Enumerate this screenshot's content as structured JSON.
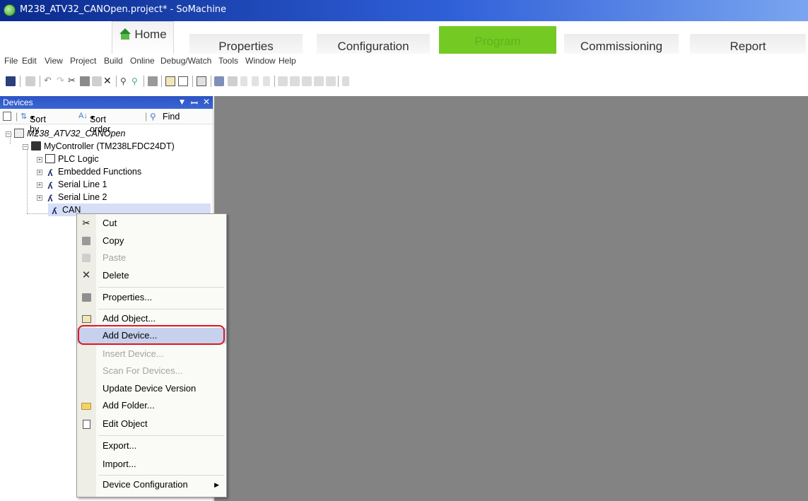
{
  "window": {
    "title": "M238_ATV32_CANOpen.project* - SoMachine"
  },
  "ribbon": {
    "tabs": [
      {
        "label": "Home"
      },
      {
        "label": "Properties"
      },
      {
        "label": "Configuration"
      },
      {
        "label": "Program"
      },
      {
        "label": "Commissioning"
      },
      {
        "label": "Report"
      }
    ]
  },
  "menu": {
    "items": [
      "File",
      "Edit",
      "View",
      "Project",
      "Build",
      "Online",
      "Debug/Watch",
      "Tools",
      "Window",
      "Help"
    ]
  },
  "devices_pane": {
    "title": "Devices",
    "sort_by": "Sort by",
    "sort_order": "Sort order",
    "find": "Find",
    "tree": {
      "project": "M238_ATV32_CANOpen",
      "controller": "MyController (TM238LFDC24DT)",
      "children": [
        "PLC Logic",
        "Embedded Functions",
        "Serial Line 1",
        "Serial Line 2",
        "CAN"
      ]
    }
  },
  "context_menu": {
    "items": [
      {
        "label": "Cut",
        "icon": "scissors-icon",
        "enabled": true
      },
      {
        "label": "Copy",
        "icon": "copy-icon",
        "enabled": true
      },
      {
        "label": "Paste",
        "icon": "paste-icon",
        "enabled": false
      },
      {
        "label": "Delete",
        "icon": "delete-icon",
        "enabled": true
      },
      {
        "label": "Properties...",
        "icon": "properties-icon",
        "enabled": true
      },
      {
        "label": "Add Object...",
        "icon": "add-object-icon",
        "enabled": true
      },
      {
        "label": "Add Device...",
        "icon": "",
        "enabled": true,
        "highlighted": true
      },
      {
        "label": "Insert Device...",
        "icon": "",
        "enabled": false
      },
      {
        "label": "Scan For Devices...",
        "icon": "",
        "enabled": false
      },
      {
        "label": "Update Device Version",
        "icon": "",
        "enabled": true
      },
      {
        "label": "Add Folder...",
        "icon": "folder-icon",
        "enabled": true
      },
      {
        "label": "Edit Object",
        "icon": "edit-object-icon",
        "enabled": true
      },
      {
        "label": "Export...",
        "icon": "",
        "enabled": true
      },
      {
        "label": "Import...",
        "icon": "",
        "enabled": true
      },
      {
        "label": "Device Configuration",
        "icon": "",
        "enabled": true,
        "submenu": true
      }
    ]
  },
  "colors": {
    "program_tab": "#74c923",
    "titlebar": "#0a2a8c",
    "workarea": "#838383",
    "highlight_ring": "#e0161d"
  }
}
